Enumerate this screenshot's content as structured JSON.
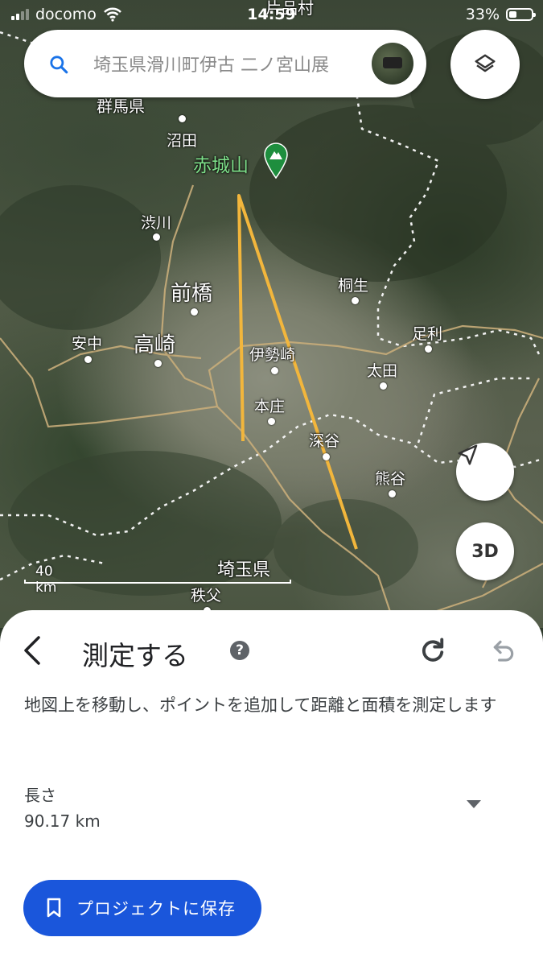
{
  "status_bar": {
    "carrier": "docomo",
    "time": "14:59",
    "battery": "33%"
  },
  "search": {
    "query": "埼玉県滑川町伊古 二ノ宮山展"
  },
  "map": {
    "places": [
      {
        "id": "p1",
        "name": "片品村"
      },
      {
        "id": "p2",
        "name": "群馬県"
      },
      {
        "id": "p3",
        "name": "沼田"
      },
      {
        "id": "p4",
        "name": "赤城山"
      },
      {
        "id": "p5",
        "name": "渋川"
      },
      {
        "id": "p6",
        "name": "前橋"
      },
      {
        "id": "p7",
        "name": "桐生"
      },
      {
        "id": "p8",
        "name": "安中"
      },
      {
        "id": "p9",
        "name": "高崎"
      },
      {
        "id": "p10",
        "name": "伊勢崎"
      },
      {
        "id": "p11",
        "name": "足利"
      },
      {
        "id": "p12",
        "name": "太田"
      },
      {
        "id": "p13",
        "name": "本庄"
      },
      {
        "id": "p14",
        "name": "深谷"
      },
      {
        "id": "p15",
        "name": "熊谷"
      },
      {
        "id": "p16",
        "name": "埼玉県"
      },
      {
        "id": "p17",
        "name": "秩父"
      }
    ],
    "scale_label": "40 km",
    "btn_3d": "3D",
    "measure_line_color": "#f2b63c",
    "park_pin_color": "#1e8e3e",
    "place_label_poi_color": "#7ee08a"
  },
  "panel": {
    "title": "測定する",
    "help": "?",
    "description": "地図上を移動し、ポイントを追加して距離と面積を測定します",
    "length_label": "長さ",
    "length_value": "90.17 km",
    "save_label": "プロジェクトに保存",
    "accent_color": "#1a56db"
  }
}
